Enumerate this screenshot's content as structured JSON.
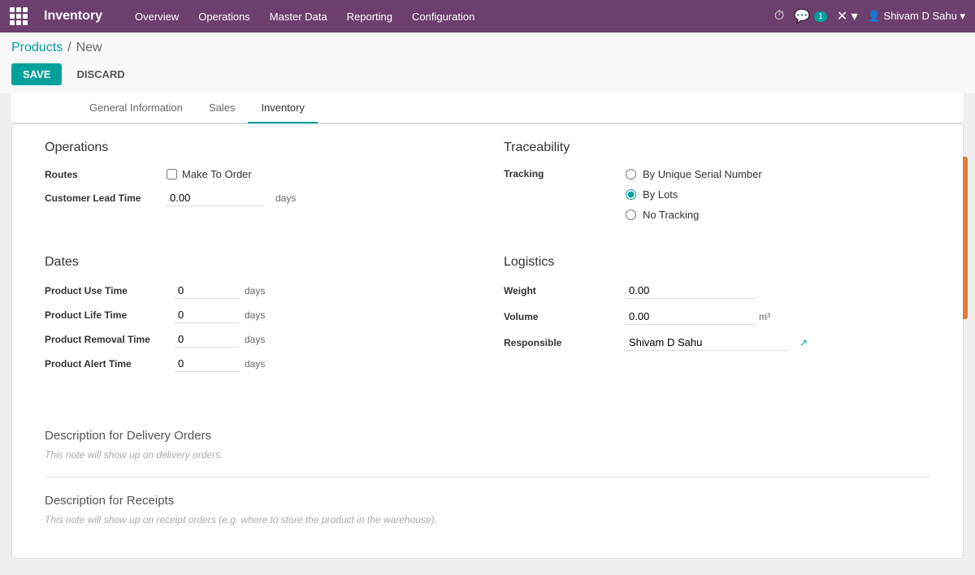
{
  "navbar": {
    "brand": "Inventory",
    "menu": [
      "Overview",
      "Operations",
      "Master Data",
      "Reporting",
      "Configuration"
    ],
    "notification_count": "1",
    "user": "Shivam D Sahu"
  },
  "breadcrumb": {
    "link": "Products",
    "separator": "/",
    "current": "New"
  },
  "actions": {
    "save": "SAVE",
    "discard": "DISCARD"
  },
  "tabs": [
    {
      "label": "General Information",
      "active": false
    },
    {
      "label": "Sales",
      "active": false
    },
    {
      "label": "Inventory",
      "active": true
    }
  ],
  "operations": {
    "title": "Operations",
    "routes_label": "Routes",
    "routes_checkbox_label": "Make To Order",
    "customer_lead_time_label": "Customer Lead Time",
    "customer_lead_time_value": "0.00",
    "customer_lead_time_unit": "days"
  },
  "traceability": {
    "title": "Traceability",
    "tracking_label": "Tracking",
    "options": [
      {
        "label": "By Unique Serial Number",
        "selected": false
      },
      {
        "label": "By Lots",
        "selected": true
      },
      {
        "label": "No Tracking",
        "selected": false
      }
    ]
  },
  "dates": {
    "title": "Dates",
    "fields": [
      {
        "label": "Product Use Time",
        "value": "0",
        "unit": "days"
      },
      {
        "label": "Product Life Time",
        "value": "0",
        "unit": "days"
      },
      {
        "label": "Product Removal Time",
        "value": "0",
        "unit": "days"
      },
      {
        "label": "Product Alert Time",
        "value": "0",
        "unit": "days"
      }
    ]
  },
  "logistics": {
    "title": "Logistics",
    "weight_label": "Weight",
    "weight_value": "0.00",
    "volume_label": "Volume",
    "volume_value": "0.00",
    "volume_unit": "m³",
    "responsible_label": "Responsible",
    "responsible_value": "Shivam D Sahu"
  },
  "descriptions": [
    {
      "title": "Description for Delivery Orders",
      "note": "This note will show up on delivery orders."
    },
    {
      "title": "Description for Receipts",
      "note": "This note will show up on receipt orders (e.g. where to store the product in the warehouse)."
    }
  ]
}
